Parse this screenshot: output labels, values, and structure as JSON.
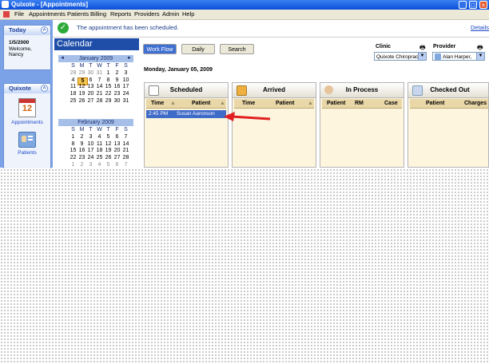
{
  "window": {
    "title": "Quixote - [Appointments]"
  },
  "menu": [
    "File",
    "Appointments",
    "Patients",
    "Billing",
    "Reports",
    "Providers",
    "Admin",
    "Help"
  ],
  "notification": {
    "message": "The appointment has been scheduled.",
    "details": "Details"
  },
  "sidebar": {
    "today": {
      "header": "Today",
      "date": "1/5/2000",
      "welcome": "Welcome,",
      "user": "Nancy"
    },
    "quixote": {
      "header": "Quixote",
      "items": [
        {
          "label": "Appointments",
          "icon": "calendar-icon",
          "number": "12"
        },
        {
          "label": "Patients",
          "icon": "patient-card-icon"
        }
      ]
    }
  },
  "calendar": {
    "title": "Calendar",
    "day_headers": [
      "S",
      "M",
      "T",
      "W",
      "T",
      "F",
      "S"
    ],
    "january": {
      "label": "January 2009",
      "rows": [
        [
          "28",
          "29",
          "30",
          "31",
          "1",
          "2",
          "3"
        ],
        [
          "4",
          "5",
          "6",
          "7",
          "8",
          "9",
          "10"
        ],
        [
          "11",
          "12",
          "13",
          "14",
          "15",
          "16",
          "17"
        ],
        [
          "18",
          "19",
          "20",
          "21",
          "22",
          "23",
          "24"
        ],
        [
          "25",
          "26",
          "27",
          "28",
          "29",
          "30",
          "31"
        ]
      ]
    },
    "february": {
      "label": "February 2009",
      "rows": [
        [
          "1",
          "2",
          "3",
          "4",
          "5",
          "6",
          "7"
        ],
        [
          "8",
          "9",
          "10",
          "11",
          "12",
          "13",
          "14"
        ],
        [
          "15",
          "16",
          "17",
          "18",
          "19",
          "20",
          "21"
        ],
        [
          "22",
          "23",
          "24",
          "25",
          "26",
          "27",
          "28"
        ],
        [
          "1",
          "2",
          "3",
          "4",
          "5",
          "6",
          "7"
        ]
      ]
    },
    "today_day": "5"
  },
  "tabs": [
    "Work Flow",
    "Daily",
    "Search"
  ],
  "active_tab": "Work Flow",
  "filters": {
    "clinic_label": "Clinic",
    "clinic_value": "Quixote Chiroprac",
    "provider_label": "Provider",
    "provider_value": "Alan Harper,"
  },
  "date_heading": "Monday, January 05, 2009",
  "columns": [
    {
      "title": "Scheduled",
      "headers": [
        "Time",
        "Patient"
      ],
      "icon": "calendar-12-icon"
    },
    {
      "title": "Arrived",
      "headers": [
        "Time",
        "Patient"
      ],
      "icon": "clipboard-icon"
    },
    {
      "title": "In Process",
      "headers": [
        "Patient",
        "RM",
        "Case"
      ],
      "icon": "person-icon"
    },
    {
      "title": "Checked Out",
      "headers": [
        "Patient",
        "Charges"
      ],
      "icon": "checkout-icon"
    }
  ],
  "scheduled_rows": [
    {
      "time": "2:45 PM",
      "patient": "Susan Aaronson"
    }
  ],
  "colors": {
    "accent": "#3f6bc9",
    "arrow": "#e02020",
    "column_bg": "#fdf5de",
    "today_highlight": "#f4c64d"
  }
}
